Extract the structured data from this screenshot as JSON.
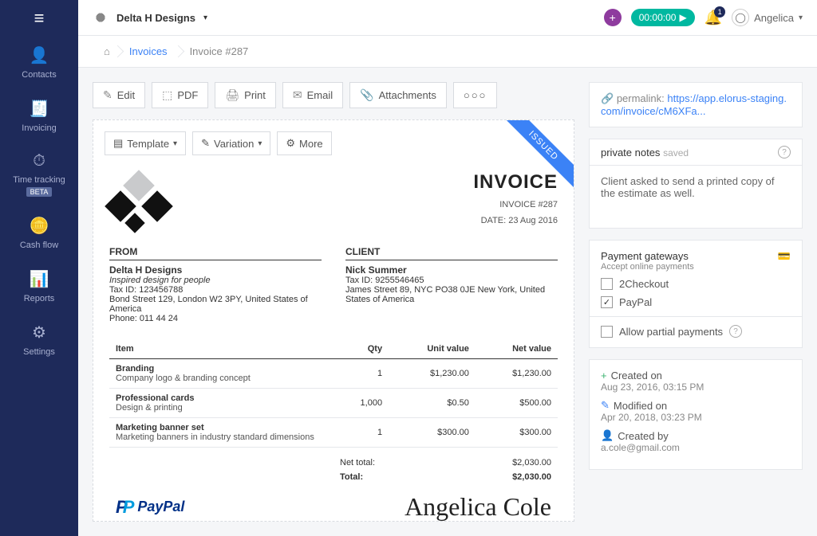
{
  "org": {
    "name": "Delta H Designs"
  },
  "user": {
    "name": "Angelica"
  },
  "timer": {
    "value": "00:00:00"
  },
  "notifications": {
    "count": "1"
  },
  "sidebar": {
    "items": [
      {
        "label": "Contacts"
      },
      {
        "label": "Invoicing"
      },
      {
        "label": "Time tracking",
        "badge": "BETA"
      },
      {
        "label": "Cash flow"
      },
      {
        "label": "Reports"
      },
      {
        "label": "Settings"
      }
    ]
  },
  "breadcrumb": {
    "l1": "Invoices",
    "l2": "Invoice #287"
  },
  "actions": {
    "edit": "Edit",
    "pdf": "PDF",
    "print": "Print",
    "email": "Email",
    "attachments": "Attachments"
  },
  "docbar": {
    "template": "Template",
    "variation": "Variation",
    "more": "More"
  },
  "ribbon": "ISSUED",
  "invoice": {
    "title": "INVOICE",
    "number": "INVOICE #287",
    "date": "DATE: 23 Aug 2016",
    "from_label": "FROM",
    "client_label": "CLIENT",
    "from": {
      "name": "Delta H Designs",
      "tagline": "Inspired design for people",
      "tax": "Tax ID: 123456788",
      "addr": "Bond Street 129, London W2 3PY, United States of America",
      "phone": "Phone: 011 44 24"
    },
    "client": {
      "name": "Nick Summer",
      "tax": "Tax ID: 9255546465",
      "addr": "James Street 89, NYC PO38 0JE New York, United States of America"
    },
    "headers": {
      "item": "Item",
      "qty": "Qty",
      "unit": "Unit value",
      "net": "Net value"
    },
    "items": [
      {
        "name": "Branding",
        "desc": "Company logo & branding concept",
        "qty": "1",
        "unit": "$1,230.00",
        "net": "$1,230.00"
      },
      {
        "name": "Professional cards",
        "desc": "Design & printing",
        "qty": "1,000",
        "unit": "$0.50",
        "net": "$500.00"
      },
      {
        "name": "Marketing banner set",
        "desc": "Marketing banners in industry standard dimensions",
        "qty": "1",
        "unit": "$300.00",
        "net": "$300.00"
      }
    ],
    "totals": {
      "net_label": "Net total:",
      "net": "$2,030.00",
      "total_label": "Total:",
      "total": "$2,030.00"
    },
    "paypal": "PayPal",
    "signature": "Angelica Cole"
  },
  "permalink": {
    "label": "permalink:",
    "url": "https://app.elorus-staging.com/invoice/cM6XFa..."
  },
  "notes": {
    "title": "private notes",
    "status": "saved",
    "text": "Client asked to send a printed copy of the estimate as well."
  },
  "gateways": {
    "title": "Payment gateways",
    "subtitle": "Accept online payments",
    "opt1": "2Checkout",
    "opt2": "PayPal",
    "partial": "Allow partial payments"
  },
  "meta": {
    "created_label": "Created on",
    "created_val": "Aug 23, 2016, 03:15 PM",
    "modified_label": "Modified on",
    "modified_val": "Apr 20, 2018, 03:23 PM",
    "by_label": "Created by",
    "by_val": "a.cole@gmail.com"
  }
}
